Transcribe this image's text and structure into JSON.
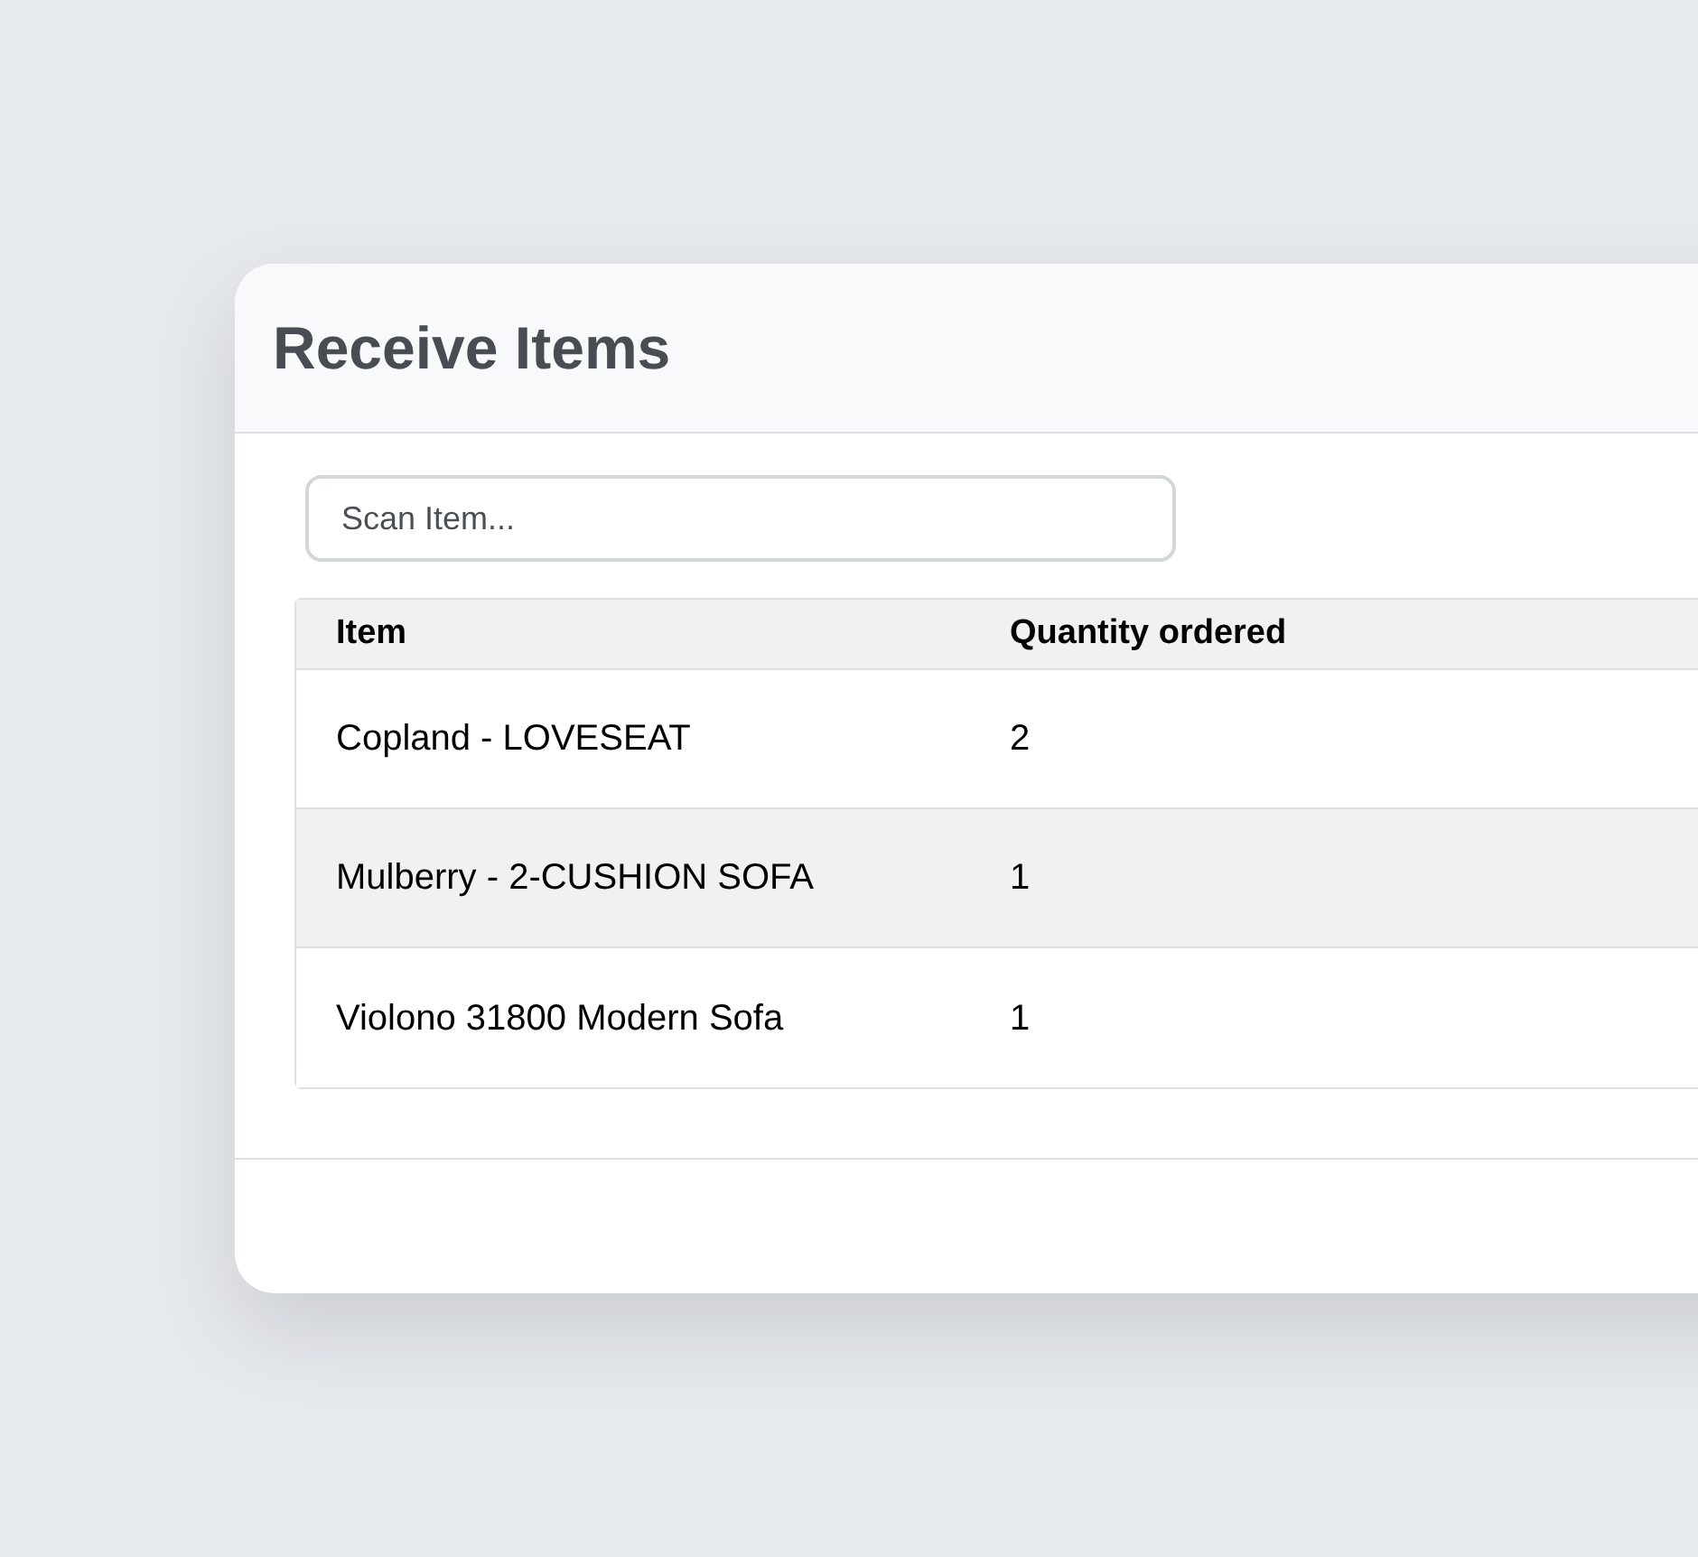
{
  "dialog": {
    "title": "Receive Items"
  },
  "scan_field": {
    "placeholder": "Scan Item..."
  },
  "table": {
    "columns": [
      "Item",
      "Quantity ordered"
    ],
    "rows": [
      {
        "cells": [
          "Copland - LOVESEAT",
          "2"
        ]
      },
      {
        "cells": [
          "Mulberry - 2-CUSHION SOFA",
          "1"
        ]
      },
      {
        "cells": [
          "Violono 31800 Modern Sofa",
          "1"
        ]
      }
    ]
  }
}
